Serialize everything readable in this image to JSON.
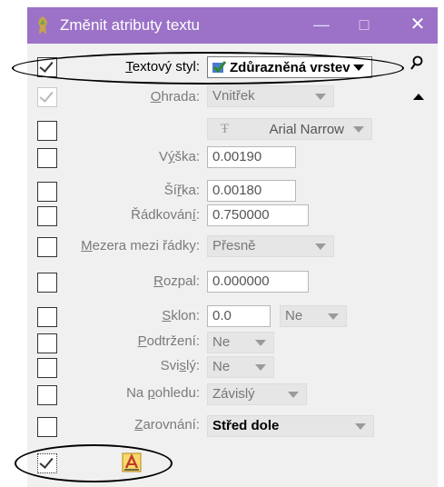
{
  "window": {
    "title": "Změnit atributy textu",
    "minimize": "—",
    "maximize": "□",
    "close": "✕"
  },
  "rows": {
    "text_style": {
      "label_prefix": "",
      "label_accel": "T",
      "label_rest": "extový styl:",
      "value": "Zdůrazněná vrstev",
      "checked": true
    },
    "frame": {
      "label_accel": "O",
      "label_rest": "hrada:",
      "value": "Vnitřek",
      "checked": true
    },
    "font": {
      "value": "Arial Narrow",
      "font_glyph": "Ŧ",
      "checked": false
    },
    "height": {
      "label_prefix": "V",
      "label_accel": "ý",
      "label_rest": "ška:",
      "value": "0.00190",
      "checked": false
    },
    "width": {
      "label_prefix": "Ší",
      "label_accel": "ř",
      "label_rest": "ka:",
      "value": "0.00180",
      "checked": false
    },
    "line_spacing": {
      "label_prefix": "Řádkován",
      "label_accel": "í",
      "label_rest": ":",
      "value": "0.750000",
      "checked": false
    },
    "line_gap": {
      "label_prefix": "",
      "label_accel": "M",
      "label_rest": "ezera mezi řádky:",
      "value": "Přesně",
      "checked": false
    },
    "spacing": {
      "label_accel": "R",
      "label_rest": "ozpal:",
      "value": "0.000000",
      "checked": false
    },
    "slant": {
      "label_accel": "S",
      "label_rest": "klon:",
      "value": "0.0",
      "value2": "Ne",
      "checked": false
    },
    "underline": {
      "label_accel": "P",
      "label_rest": "odtržení:",
      "value": "Ne",
      "checked": false
    },
    "vertical": {
      "label_prefix": "Svi",
      "label_accel": "s",
      "label_rest": "lý:",
      "value": "Ne",
      "checked": false
    },
    "view_dependent": {
      "label_prefix": "Na ",
      "label_accel": "p",
      "label_rest": "ohledu:",
      "value": "Závislý",
      "checked": false
    },
    "justification": {
      "label_accel": "Z",
      "label_rest": "arovnání:",
      "value": "Střed dole",
      "checked": false
    }
  },
  "bottom": {
    "checked": true,
    "match_icon": "text-match-icon"
  },
  "icons": {
    "style_icon": "checkmark-style-icon",
    "magnifier": "magnifier-icon",
    "scroll_up": "scroll-up-icon",
    "app_icon": "microstation-icon"
  },
  "colors": {
    "titlebar": "#9b72c7",
    "panel": "#f0f0f0",
    "annotation": "#000000"
  }
}
